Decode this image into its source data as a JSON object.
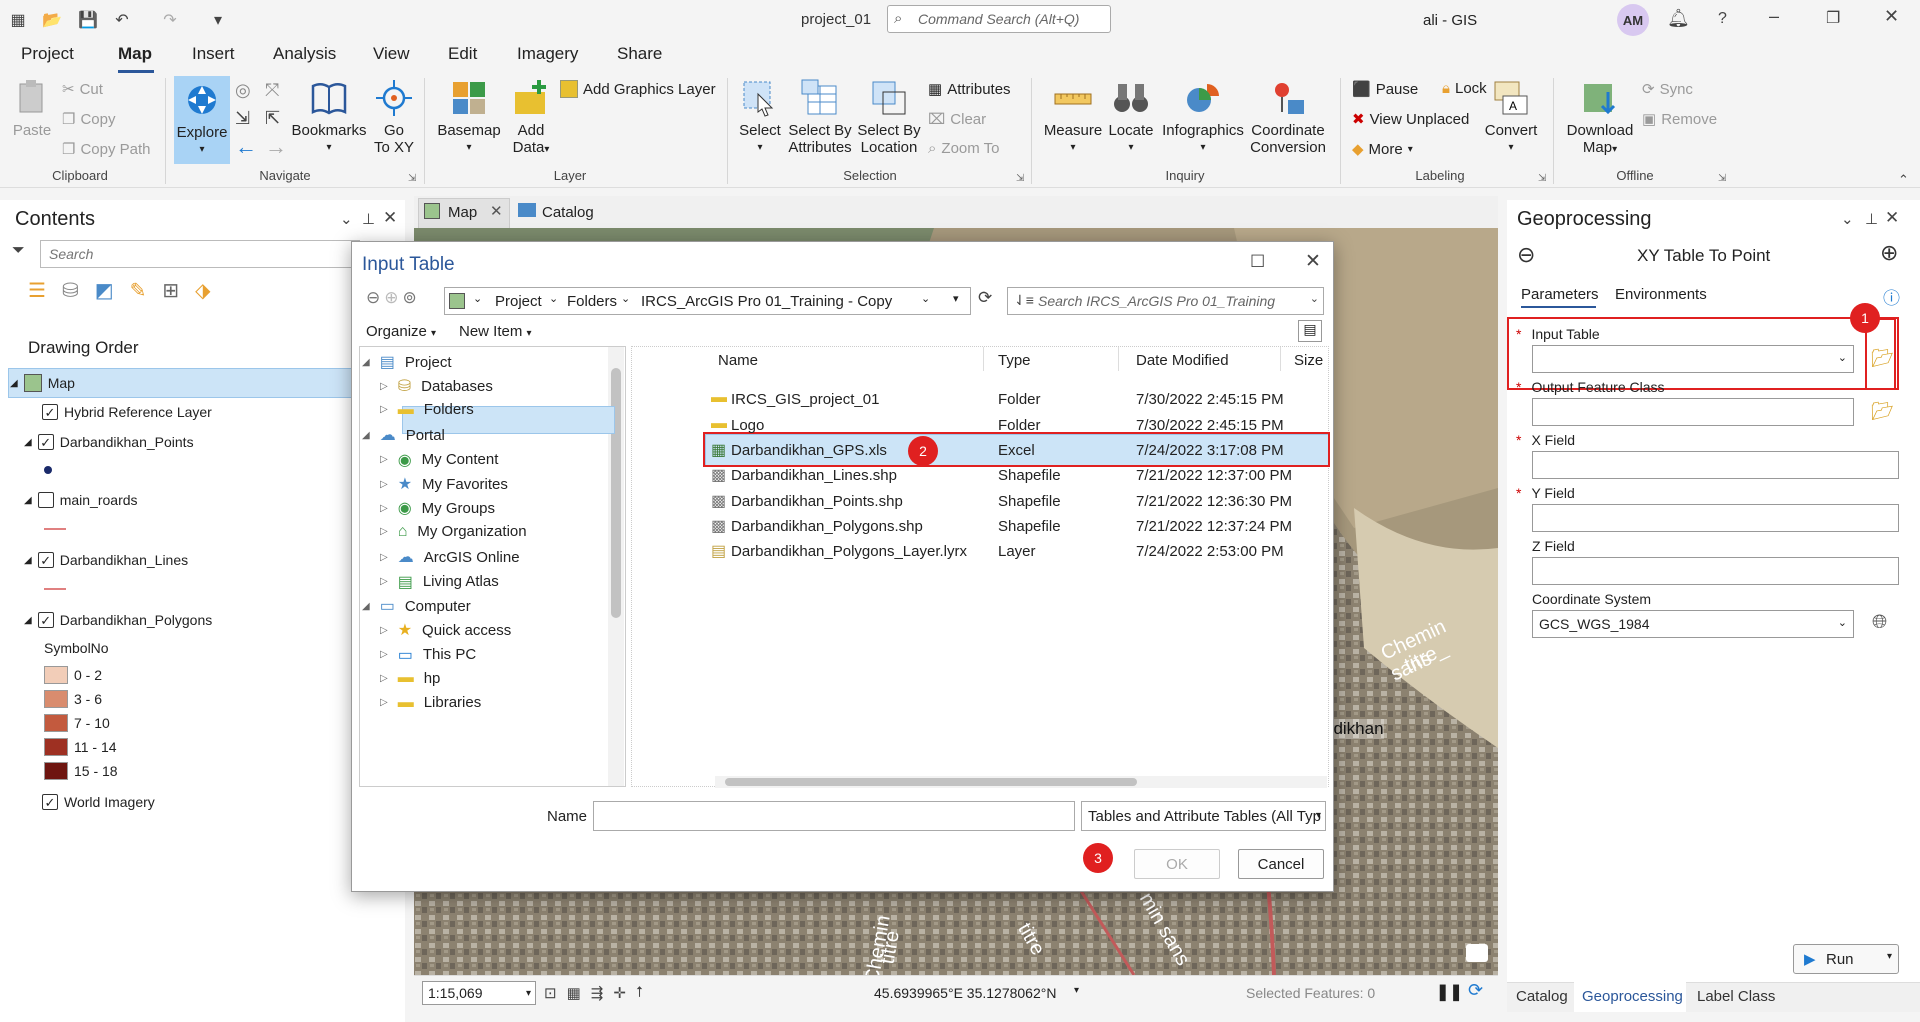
{
  "app": {
    "project": "project_01",
    "search_placeholder": "Command Search (Alt+Q)",
    "user": "ali - GIS",
    "avatar": "AM",
    "help": "?"
  },
  "menu": [
    "Project",
    "Map",
    "Insert",
    "Analysis",
    "View",
    "Edit",
    "Imagery",
    "Share"
  ],
  "ribbon": {
    "clipboard": {
      "paste": "Paste",
      "cut": "Cut",
      "copy": "Copy",
      "copy_path": "Copy Path",
      "label": "Clipboard"
    },
    "navigate": {
      "explore": "Explore",
      "bookmarks": "Bookmarks",
      "goto": "Go",
      "goto2": "To XY",
      "label": "Navigate"
    },
    "layer": {
      "basemap": "Basemap",
      "add_data": "Add",
      "add_data2": "Data",
      "add_graphics": "Add Graphics Layer",
      "label": "Layer"
    },
    "selection": {
      "select": "Select",
      "select_attr": "Select By",
      "select_attr2": "Attributes",
      "select_loc": "Select By",
      "select_loc2": "Location",
      "attributes": "Attributes",
      "clear": "Clear",
      "zoom_to": "Zoom To",
      "label": "Selection"
    },
    "inquiry": {
      "measure": "Measure",
      "locate": "Locate",
      "infographics": "Infographics",
      "coord": "Coordinate",
      "coord2": "Conversion",
      "label": "Inquiry"
    },
    "labeling": {
      "pause": "Pause",
      "lock": "Lock",
      "view_unplaced": "View Unplaced",
      "more": "More",
      "convert": "Convert",
      "label": "Labeling"
    },
    "offline": {
      "download": "Download",
      "download2": "Map",
      "sync": "Sync",
      "remove": "Remove",
      "label": "Offline"
    }
  },
  "contents": {
    "title": "Contents",
    "search_placeholder": "Search",
    "drawing_order": "Drawing Order",
    "map": "Map",
    "layers": [
      "Hybrid Reference Layer",
      "Darbandikhan_Points",
      "main_roards",
      "Darbandikhan_Lines",
      "Darbandikhan_Polygons"
    ],
    "symbol_header": "SymbolNo",
    "classes": [
      {
        "label": "0 - 2",
        "color": "#f2cdb8"
      },
      {
        "label": "3 - 6",
        "color": "#d98c6e"
      },
      {
        "label": "7 - 10",
        "color": "#c35a3e"
      },
      {
        "label": "11 - 14",
        "color": "#9e3022"
      },
      {
        "label": "15 - 18",
        "color": "#6e1510"
      }
    ],
    "world_imagery": "World Imagery"
  },
  "map_tabs": [
    "Map",
    "Catalog"
  ],
  "map": {
    "labels": [
      "Chemin sans",
      "titre_",
      "ndikhan",
      "Chemin",
      "titre",
      "min sans",
      "titre"
    ],
    "scale": "1:15,069",
    "coords": "45.6939965°E 35.1278062°N",
    "selected": "Selected Features: 0"
  },
  "dialog": {
    "title": "Input Table",
    "path": [
      "Project",
      "Folders",
      "IRCS_ArcGIS Pro 01_Training - Copy"
    ],
    "search_placeholder": "Search IRCS_ArcGIS Pro 01_Training",
    "organize": "Organize",
    "new_item": "New Item",
    "nav": [
      {
        "label": "Project",
        "level": 0
      },
      {
        "label": "Databases",
        "level": 1
      },
      {
        "label": "Folders",
        "level": 1
      },
      {
        "label": "Portal",
        "level": 0
      },
      {
        "label": "My Content",
        "level": 1
      },
      {
        "label": "My Favorites",
        "level": 1
      },
      {
        "label": "My Groups",
        "level": 1
      },
      {
        "label": "My Organization",
        "level": 1
      },
      {
        "label": "ArcGIS Online",
        "level": 1
      },
      {
        "label": "Living Atlas",
        "level": 1
      },
      {
        "label": "Computer",
        "level": 0
      },
      {
        "label": "Quick access",
        "level": 1
      },
      {
        "label": "This PC",
        "level": 1
      },
      {
        "label": "hp",
        "level": 1
      },
      {
        "label": "Libraries",
        "level": 1
      }
    ],
    "columns": [
      "Name",
      "Type",
      "Date Modified",
      "Size"
    ],
    "files": [
      {
        "name": "IRCS_GIS_project_01",
        "type": "Folder",
        "date": "7/30/2022 2:45:15 PM"
      },
      {
        "name": "Logo",
        "type": "Folder",
        "date": "7/30/2022 2:45:15 PM"
      },
      {
        "name": "Darbandikhan_GPS.xls",
        "type": "Excel",
        "date": "7/24/2022 3:17:08 PM"
      },
      {
        "name": "Darbandikhan_Lines.shp",
        "type": "Shapefile",
        "date": "7/21/2022 12:37:00 PM"
      },
      {
        "name": "Darbandikhan_Points.shp",
        "type": "Shapefile",
        "date": "7/21/2022 12:36:30 PM"
      },
      {
        "name": "Darbandikhan_Polygons.shp",
        "type": "Shapefile",
        "date": "7/21/2022 12:37:24 PM"
      },
      {
        "name": "Darbandikhan_Polygons_Layer.lyrx",
        "type": "Layer",
        "date": "7/24/2022 2:53:00 PM"
      }
    ],
    "name_label": "Name",
    "filter": "Tables and Attribute Tables (All Typ",
    "ok": "OK",
    "cancel": "Cancel",
    "badge2": "2",
    "badge3": "3"
  },
  "geo": {
    "title": "Geoprocessing",
    "tool": "XY Table To Point",
    "tabs": [
      "Parameters",
      "Environments"
    ],
    "fields": [
      "Input Table",
      "Output Feature Class",
      "X Field",
      "Y Field",
      "Z Field",
      "Coordinate System"
    ],
    "cs_value": "GCS_WGS_1984",
    "badge1": "1",
    "run": "Run"
  },
  "bottom_tabs": [
    "Catalog",
    "Geoprocessing",
    "Label Class"
  ],
  "colors": {
    "accent": "#2b579a",
    "highlight": "#e02020",
    "selected_bg": "#cce4f7"
  }
}
